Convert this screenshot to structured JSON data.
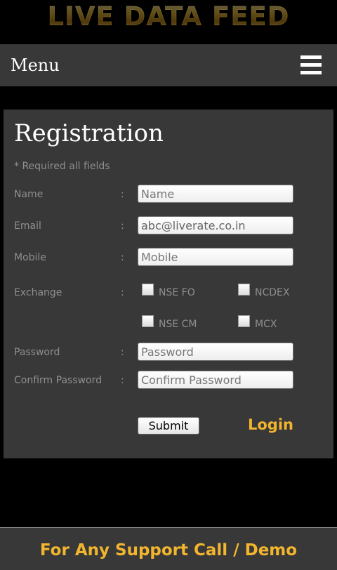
{
  "brand": {
    "title": "LIVE DATA FEED"
  },
  "menu": {
    "label": "Menu",
    "icon": "hamburger-icon"
  },
  "registration": {
    "title": "Registration",
    "required_note": "* Required all fields",
    "colon": ":",
    "name": {
      "label": "Name",
      "placeholder": "Name",
      "value": ""
    },
    "email": {
      "label": "Email",
      "placeholder": "Email",
      "value": "abc@liverate.co.in"
    },
    "mobile": {
      "label": "Mobile",
      "placeholder": "Mobile",
      "value": ""
    },
    "exchange": {
      "label": "Exchange",
      "options": [
        {
          "label": "NSE FO",
          "checked": false
        },
        {
          "label": "NCDEX",
          "checked": false
        },
        {
          "label": "NSE CM",
          "checked": false
        },
        {
          "label": "MCX",
          "checked": false
        }
      ]
    },
    "password": {
      "label": "Password",
      "placeholder": "Password",
      "value": ""
    },
    "confirm_password": {
      "label": "Confirm Password",
      "placeholder": "Confirm Password",
      "value": ""
    },
    "submit_label": "Submit",
    "login_label": "Login"
  },
  "footer": {
    "support_text": "For Any Support Call / Demo"
  },
  "colors": {
    "accent": "#f2b52e",
    "panel": "#383838",
    "background": "#000000",
    "label": "#8f8f8f"
  }
}
